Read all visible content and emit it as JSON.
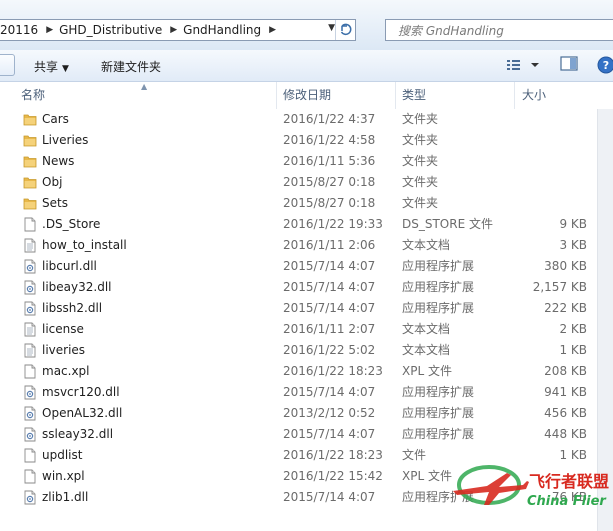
{
  "address_bar": {
    "crumbs": [
      "20116",
      "GHD_Distributive",
      "GndHandling"
    ]
  },
  "search": {
    "placeholder": "搜索 GndHandling"
  },
  "toolbar": {
    "share_label": "共享",
    "new_folder_label": "新建文件夹"
  },
  "columns": {
    "name": "名称",
    "date": "修改日期",
    "type": "类型",
    "size": "大小"
  },
  "files": [
    {
      "name": "Cars",
      "date": "2016/1/22 4:37",
      "type": "文件夹",
      "size": "",
      "icon": "folder-icon"
    },
    {
      "name": "Liveries",
      "date": "2016/1/22 4:58",
      "type": "文件夹",
      "size": "",
      "icon": "folder-icon"
    },
    {
      "name": "News",
      "date": "2016/1/11 5:36",
      "type": "文件夹",
      "size": "",
      "icon": "folder-icon"
    },
    {
      "name": "Obj",
      "date": "2015/8/27 0:18",
      "type": "文件夹",
      "size": "",
      "icon": "folder-icon"
    },
    {
      "name": "Sets",
      "date": "2015/8/27 0:18",
      "type": "文件夹",
      "size": "",
      "icon": "folder-icon"
    },
    {
      "name": ".DS_Store",
      "date": "2016/1/22 19:33",
      "type": "DS_STORE 文件",
      "size": "9 KB",
      "icon": "file-icon"
    },
    {
      "name": "how_to_install",
      "date": "2016/1/11 2:06",
      "type": "文本文档",
      "size": "3 KB",
      "icon": "text-file-icon"
    },
    {
      "name": "libcurl.dll",
      "date": "2015/7/14 4:07",
      "type": "应用程序扩展",
      "size": "380 KB",
      "icon": "dll-file-icon"
    },
    {
      "name": "libeay32.dll",
      "date": "2015/7/14 4:07",
      "type": "应用程序扩展",
      "size": "2,157 KB",
      "icon": "dll-file-icon"
    },
    {
      "name": "libssh2.dll",
      "date": "2015/7/14 4:07",
      "type": "应用程序扩展",
      "size": "222 KB",
      "icon": "dll-file-icon"
    },
    {
      "name": "license",
      "date": "2016/1/11 2:07",
      "type": "文本文档",
      "size": "2 KB",
      "icon": "text-file-icon"
    },
    {
      "name": "liveries",
      "date": "2016/1/22 5:02",
      "type": "文本文档",
      "size": "1 KB",
      "icon": "text-file-icon"
    },
    {
      "name": "mac.xpl",
      "date": "2016/1/22 18:23",
      "type": "XPL 文件",
      "size": "208 KB",
      "icon": "file-icon"
    },
    {
      "name": "msvcr120.dll",
      "date": "2015/7/14 4:07",
      "type": "应用程序扩展",
      "size": "941 KB",
      "icon": "dll-file-icon"
    },
    {
      "name": "OpenAL32.dll",
      "date": "2013/2/12 0:52",
      "type": "应用程序扩展",
      "size": "456 KB",
      "icon": "dll-file-icon"
    },
    {
      "name": "ssleay32.dll",
      "date": "2015/7/14 4:07",
      "type": "应用程序扩展",
      "size": "448 KB",
      "icon": "dll-file-icon"
    },
    {
      "name": "updlist",
      "date": "2016/1/22 18:23",
      "type": "文件",
      "size": "1 KB",
      "icon": "file-icon"
    },
    {
      "name": "win.xpl",
      "date": "2016/1/22 15:42",
      "type": "XPL 文件",
      "size": "",
      "icon": "file-icon"
    },
    {
      "name": "zlib1.dll",
      "date": "2015/7/14 4:07",
      "type": "应用程序扩展",
      "size": "76 KB",
      "icon": "dll-file-icon"
    }
  ],
  "watermark": {
    "cn": "飞行者联盟",
    "en": "China Flier"
  },
  "colors": {
    "folder": "#e8b84a",
    "accent": "#3b6ea8",
    "watermark_green": "#2fa84f",
    "watermark_red": "#d82a20"
  }
}
